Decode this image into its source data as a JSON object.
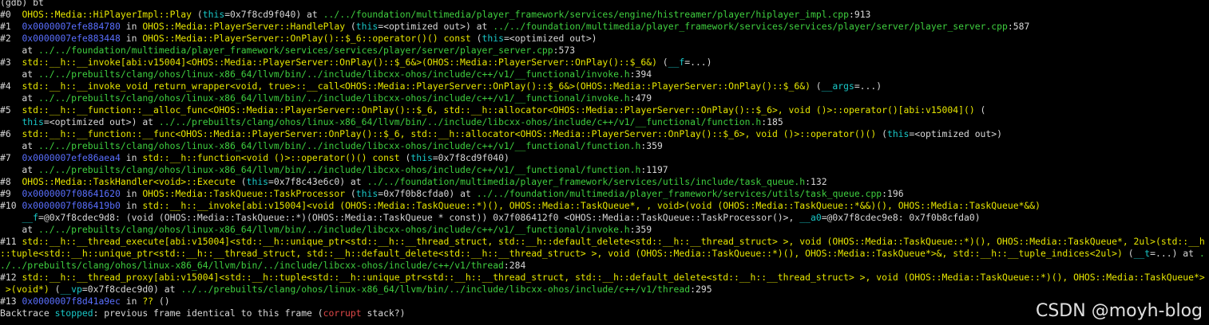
{
  "lines": [
    [
      [
        "w",
        "(gdb) bt"
      ]
    ],
    [
      [
        "w",
        "#0  "
      ],
      [
        "y",
        "OHOS::Media::HiPlayerImpl::Play"
      ],
      [
        "w",
        " ("
      ],
      [
        "c",
        "this"
      ],
      [
        "w",
        "=0x7f8cd9f040) at "
      ],
      [
        "g",
        "../../foundation/multimedia/player_framework/services/engine/histreamer/player/hiplayer_impl.cpp"
      ],
      [
        "w",
        ":913"
      ]
    ],
    [
      [
        "w",
        "#1  "
      ],
      [
        "b",
        "0x0000007efe884780"
      ],
      [
        "w",
        " in "
      ],
      [
        "y",
        "OHOS::Media::PlayerServer::HandlePlay"
      ],
      [
        "w",
        " ("
      ],
      [
        "c",
        "this"
      ],
      [
        "w",
        "=<optimized out>) at "
      ],
      [
        "g",
        "../../foundation/multimedia/player_framework/services/services/player/server/player_server.cpp"
      ],
      [
        "w",
        ":587"
      ]
    ],
    [
      [
        "w",
        "#2  "
      ],
      [
        "b",
        "0x0000007efe883448"
      ],
      [
        "w",
        " in "
      ],
      [
        "y",
        "OHOS::Media::PlayerServer::OnPlay()::$_6::operator()() const"
      ],
      [
        "w",
        " ("
      ],
      [
        "c",
        "this"
      ],
      [
        "w",
        "=<optimized out>)"
      ]
    ],
    [
      [
        "w",
        "    at "
      ],
      [
        "g",
        "../../foundation/multimedia/player_framework/services/services/player/server/player_server.cpp"
      ],
      [
        "w",
        ":573"
      ]
    ],
    [
      [
        "w",
        "#3  "
      ],
      [
        "y",
        "std::__h::__invoke[abi:v15004]<OHOS::Media::PlayerServer::OnPlay()::$_6&>(OHOS::Media::PlayerServer::OnPlay()::$_6&)"
      ],
      [
        "w",
        " ("
      ],
      [
        "c",
        "__f"
      ],
      [
        "w",
        "=...)"
      ]
    ],
    [
      [
        "w",
        "    at "
      ],
      [
        "g",
        "../../prebuilts/clang/ohos/linux-x86_64/llvm/bin/../include/libcxx-ohos/include/c++/v1/__functional/invoke.h"
      ],
      [
        "w",
        ":394"
      ]
    ],
    [
      [
        "w",
        "#4  "
      ],
      [
        "y",
        "std::__h::__invoke_void_return_wrapper<void, true>::__call<OHOS::Media::PlayerServer::OnPlay()::$_6&>(OHOS::Media::PlayerServer::OnPlay()::$_6&)"
      ],
      [
        "w",
        " ("
      ],
      [
        "c",
        "__args"
      ],
      [
        "w",
        "=...)"
      ]
    ],
    [
      [
        "w",
        "    at "
      ],
      [
        "g",
        "../../prebuilts/clang/ohos/linux-x86_64/llvm/bin/../include/libcxx-ohos/include/c++/v1/__functional/invoke.h"
      ],
      [
        "w",
        ":479"
      ]
    ],
    [
      [
        "w",
        "#5  "
      ],
      [
        "y",
        "std::__h::__function::__alloc_func<OHOS::Media::PlayerServer::OnPlay()::$_6, std::__h::allocator<OHOS::Media::PlayerServer::OnPlay()::$_6>, void ()>::operator()[abi:v15004]()"
      ],
      [
        "w",
        " ("
      ]
    ],
    [
      [
        "w",
        "    "
      ],
      [
        "c",
        "this"
      ],
      [
        "w",
        "=<optimized out>) at "
      ],
      [
        "g",
        "../../prebuilts/clang/ohos/linux-x86_64/llvm/bin/../include/libcxx-ohos/include/c++/v1/__functional/function.h"
      ],
      [
        "w",
        ":185"
      ]
    ],
    [
      [
        "w",
        "#6  "
      ],
      [
        "y",
        "std::__h::__function::__func<OHOS::Media::PlayerServer::OnPlay()::$_6, std::__h::allocator<OHOS::Media::PlayerServer::OnPlay()::$_6>, void ()>::operator()()"
      ],
      [
        "w",
        " ("
      ],
      [
        "c",
        "this"
      ],
      [
        "w",
        "=<optimized out>)"
      ]
    ],
    [
      [
        "w",
        "    at "
      ],
      [
        "g",
        "../../prebuilts/clang/ohos/linux-x86_64/llvm/bin/../include/libcxx-ohos/include/c++/v1/__functional/function.h"
      ],
      [
        "w",
        ":359"
      ]
    ],
    [
      [
        "w",
        "#7  "
      ],
      [
        "b",
        "0x0000007efe86aea4"
      ],
      [
        "w",
        " in "
      ],
      [
        "y",
        "std::__h::function<void ()>::operator()() const"
      ],
      [
        "w",
        " ("
      ],
      [
        "c",
        "this"
      ],
      [
        "w",
        "=0x7f8cd9f040)"
      ]
    ],
    [
      [
        "w",
        "    at "
      ],
      [
        "g",
        "../../prebuilts/clang/ohos/linux-x86_64/llvm/bin/../include/libcxx-ohos/include/c++/v1/__functional/function.h"
      ],
      [
        "w",
        ":1197"
      ]
    ],
    [
      [
        "w",
        "#8  "
      ],
      [
        "y",
        "OHOS::Media::TaskHandler<void>::Execute"
      ],
      [
        "w",
        " ("
      ],
      [
        "c",
        "this"
      ],
      [
        "w",
        "=0x7f8c43e6c0) at "
      ],
      [
        "g",
        "../../foundation/multimedia/player_framework/services/utils/include/task_queue.h"
      ],
      [
        "w",
        ":132"
      ]
    ],
    [
      [
        "w",
        "#9  "
      ],
      [
        "b",
        "0x0000007f08641620"
      ],
      [
        "w",
        " in "
      ],
      [
        "y",
        "OHOS::Media::TaskQueue::TaskProcessor"
      ],
      [
        "w",
        " ("
      ],
      [
        "c",
        "this"
      ],
      [
        "w",
        "=0x7f0b8cfda0) at "
      ],
      [
        "g",
        "../../foundation/multimedia/player_framework/services/utils/task_queue.cpp"
      ],
      [
        "w",
        ":196"
      ]
    ],
    [
      [
        "w",
        "#10 "
      ],
      [
        "b",
        "0x0000007f086419b0"
      ],
      [
        "w",
        " in "
      ],
      [
        "y",
        "std::__h::__invoke[abi:v15004]<void (OHOS::Media::TaskQueue::*)(), OHOS::Media::TaskQueue*, , void>(void (OHOS::Media::TaskQueue::*&&)(), OHOS::Media::TaskQueue*&&)"
      ]
    ],
    [
      [
        "w",
        "    "
      ],
      [
        "c",
        "__f"
      ],
      [
        "w",
        "=@0x7f8cdec9d8: (void (OHOS::Media::TaskQueue::*)(OHOS::Media::TaskQueue * const)) 0x7f086412f0 <OHOS::Media::TaskQueue::TaskProcessor()>, "
      ],
      [
        "c",
        "__a0"
      ],
      [
        "w",
        "=@0x7f8cdec9e8: 0x7f0b8cfda0)"
      ]
    ],
    [
      [
        "w",
        "    at "
      ],
      [
        "g",
        "../../prebuilts/clang/ohos/linux-x86_64/llvm/bin/../include/libcxx-ohos/include/c++/v1/__functional/invoke.h"
      ],
      [
        "w",
        ":359"
      ]
    ],
    [
      [
        "w",
        "#11 "
      ],
      [
        "y",
        "std::__h::__thread_execute[abi:v15004]<std::__h::unique_ptr<std::__h::__thread_struct, std::__h::default_delete<std::__h::__thread_struct> >, void (OHOS::Media::TaskQueue::*)(), OHOS::Media::TaskQueue*, 2ul>(std::__h::tuple<std::__h::unique_ptr<std::__h::__thread_struct, std::__h::default_delete<std::__h::__thread_struct> >, void (OHOS::Media::TaskQueue::*)(), OHOS::Media::TaskQueue*>&, std::__h::__tuple_indices<2ul>)"
      ],
      [
        "w",
        " ("
      ],
      [
        "c",
        "__t"
      ],
      [
        "w",
        "=...) at "
      ],
      [
        "g",
        "../../prebuilts/clang/ohos/linux-x86_64/llvm/bin/../include/libcxx-ohos/include/c++/v1/thread"
      ],
      [
        "w",
        ":284"
      ]
    ],
    [
      [
        "w",
        "#12 "
      ],
      [
        "y",
        "std::__h::__thread_proxy[abi:v15004]<std::__h::tuple<std::__h::unique_ptr<std::__h::__thread_struct, std::__h::default_delete<std::__h::__thread_struct> >, void (OHOS::Media::TaskQueue::*)(), OHOS::Media::TaskQueue*> >(void*)"
      ],
      [
        "w",
        " ("
      ],
      [
        "c",
        "__vp"
      ],
      [
        "w",
        "=0x7f8cdec9d0) at "
      ],
      [
        "g",
        "../../prebuilts/clang/ohos/linux-x86_64/llvm/bin/../include/libcxx-ohos/include/c++/v1/thread"
      ],
      [
        "w",
        ":295"
      ]
    ],
    [
      [
        "w",
        "#13 "
      ],
      [
        "b",
        "0x0000007f8d41a9ec"
      ],
      [
        "w",
        " in "
      ],
      [
        "y",
        "??"
      ],
      [
        "w",
        " ()"
      ]
    ],
    [
      [
        "w",
        "Backtrace "
      ],
      [
        "c",
        "stopped"
      ],
      [
        "w",
        ": previous frame identical to this frame ("
      ],
      [
        "r",
        "corrupt"
      ],
      [
        "w",
        " stack?)"
      ]
    ]
  ],
  "watermark": "CSDN @moyh-blog"
}
